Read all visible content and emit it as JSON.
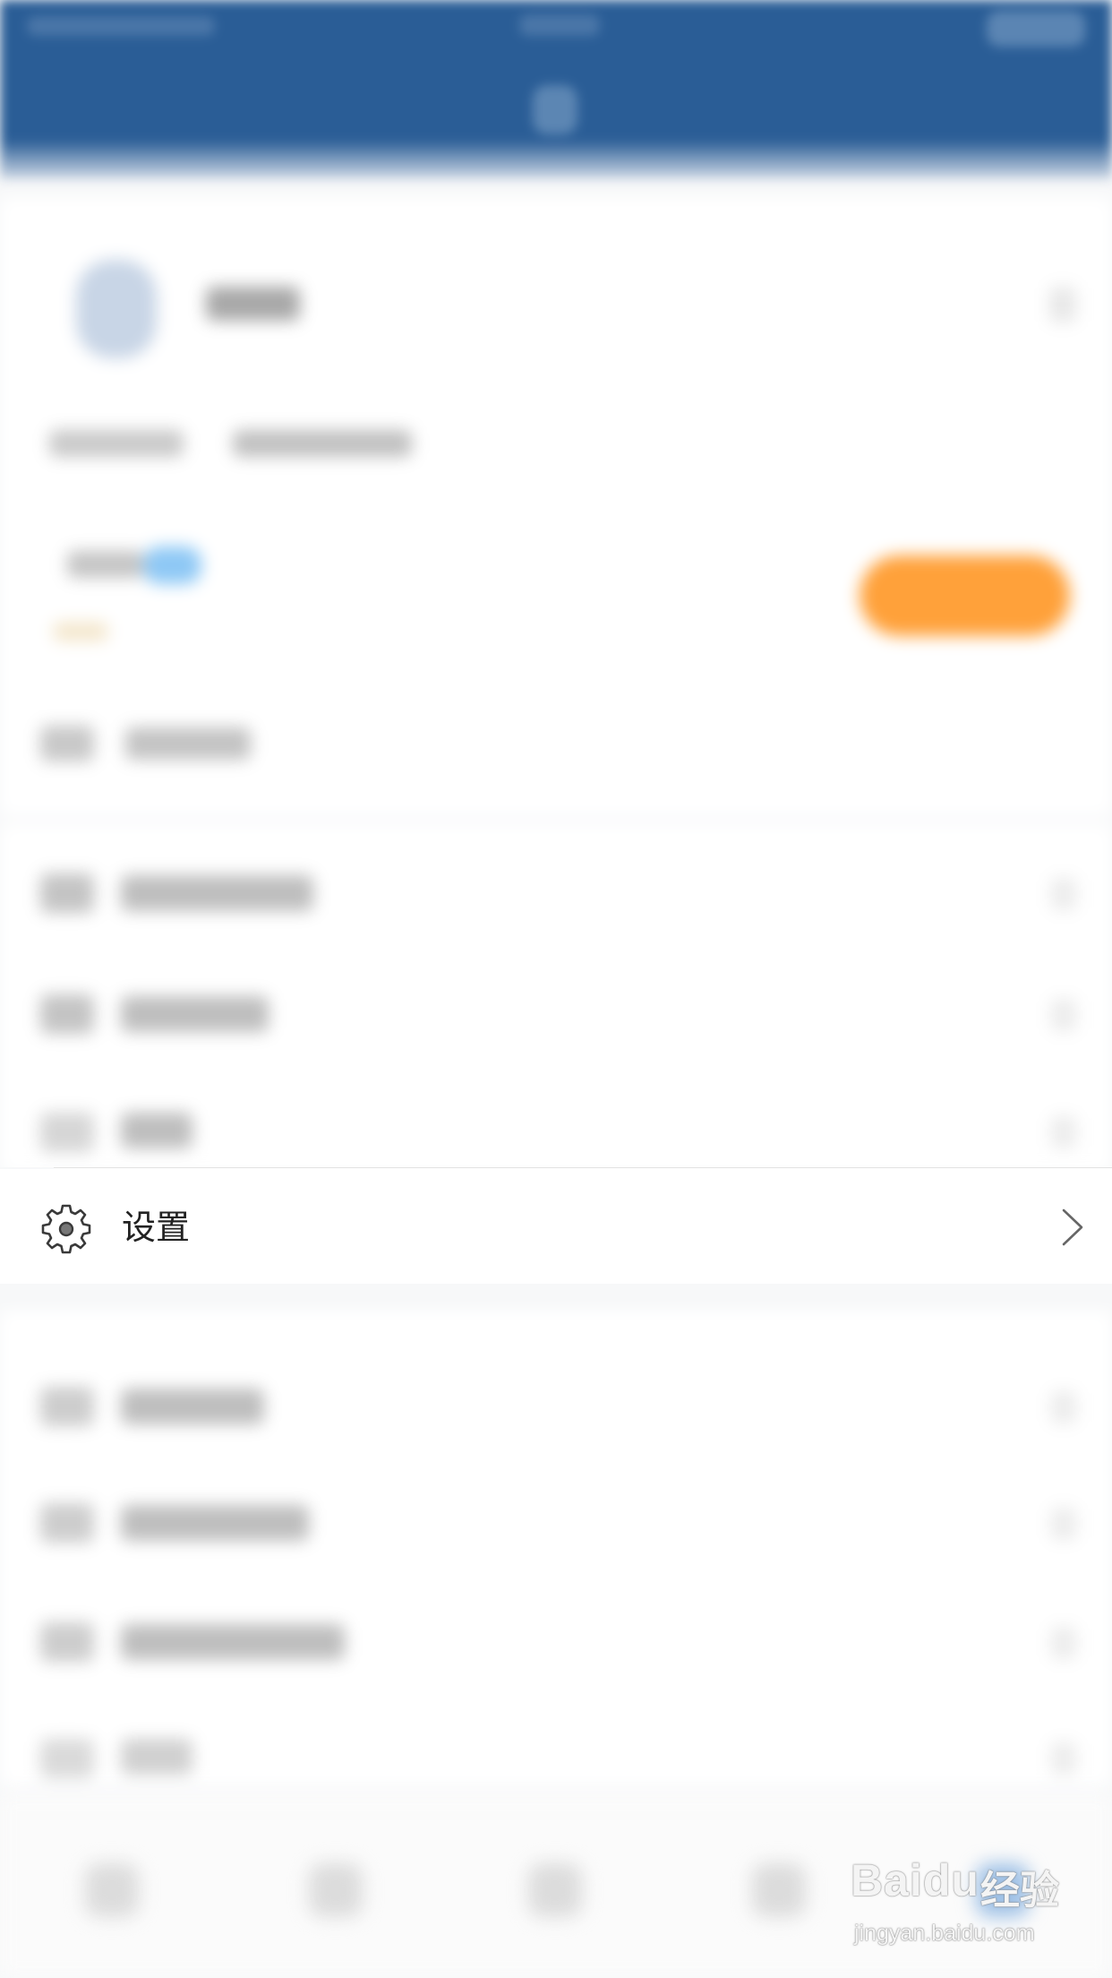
{
  "settings_row": {
    "label": "设置",
    "icon": "gear-icon",
    "chevron": "chevron-right-icon"
  },
  "watermark": {
    "brand": "Bai",
    "paw": "du",
    "cn": "经验",
    "url": "jingyan.baidu.com"
  },
  "colors": {
    "header": "#2a5d96",
    "accent_button": "#ffa13a",
    "badge": "#8ec8f5"
  }
}
